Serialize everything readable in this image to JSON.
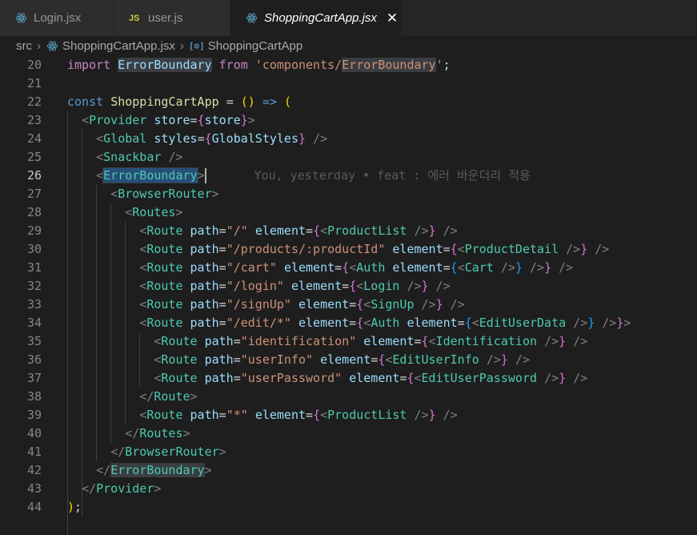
{
  "tabs": [
    {
      "label": "Login.jsx",
      "icon": "react-icon"
    },
    {
      "label": "user.js",
      "icon": "js-icon"
    },
    {
      "label": "ShoppingCartApp.jsx",
      "icon": "react-icon",
      "active": true
    }
  ],
  "tab_js_badge": "JS",
  "breadcrumb": {
    "folder": "src",
    "file": "ShoppingCartApp.jsx",
    "symbol": "ShoppingCartApp",
    "symbol_icon_text": "[⊙]"
  },
  "editor": {
    "line_numbers": [
      "20",
      "21",
      "22",
      "23",
      "24",
      "25",
      "26",
      "27",
      "28",
      "29",
      "30",
      "31",
      "32",
      "33",
      "34",
      "35",
      "36",
      "37",
      "38",
      "39",
      "40",
      "41",
      "42",
      "43",
      "44"
    ],
    "current_line": "26",
    "blame": "You, yesterday • feat : 에러 바운더리 적용"
  },
  "colors": {
    "background": "#1e1e1e",
    "tab_bar": "#252526",
    "keyword": "#569cd6",
    "component": "#4ec9b0",
    "string": "#ce9178",
    "attribute": "#9cdcfe"
  }
}
